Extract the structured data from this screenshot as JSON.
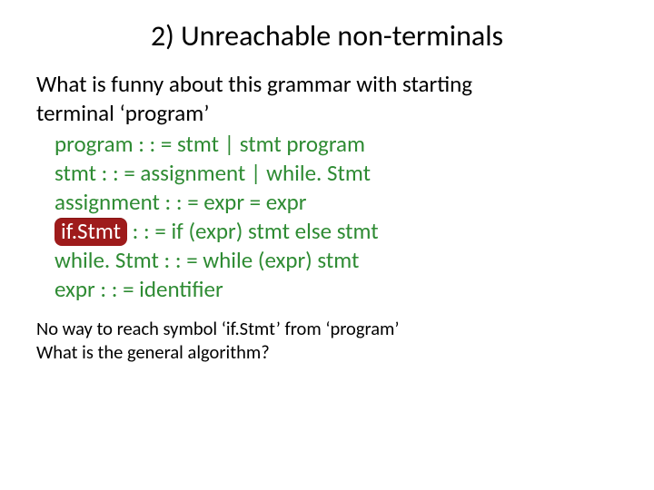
{
  "title": "2) Unreachable non-terminals",
  "intro_line1": "What is funny about this grammar with starting",
  "intro_line2": "terminal ‘program’",
  "grammar": {
    "r1": "program : : = stmt | stmt program",
    "r2": "stmt : : = assignment | while. Stmt",
    "r3": "assignment : : = expr = expr",
    "r4_lhs": "if.Stmt",
    "r4_rest": " : : = if (expr) stmt else stmt",
    "r5": "while. Stmt : : = while (expr) stmt",
    "r6": "expr : : = identifier"
  },
  "footer_line1": "No way to reach symbol ‘if.Stmt’ from ‘program’",
  "footer_line2": "What is the general algorithm?"
}
